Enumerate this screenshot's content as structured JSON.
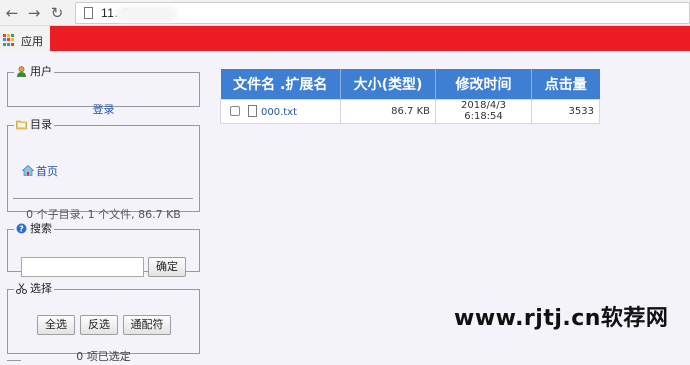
{
  "browser": {
    "url": "11.                6",
    "bookmark_apps_label": "应用",
    "accent_color": "#ec1c24"
  },
  "sidebar": {
    "user_panel": {
      "title": "用户",
      "icon": "user-icon",
      "login_link": "登录"
    },
    "directory_panel": {
      "title": "目录",
      "icon": "folder-icon",
      "home_link": "首页",
      "summary": "0 个子目录, 1 个文件, 86.7 KB"
    },
    "search_panel": {
      "title": "搜索",
      "icon": "help-icon",
      "input_value": "",
      "submit_label": "确定"
    },
    "select_panel": {
      "title": "选择",
      "icon": "scissors-icon",
      "select_all": "全选",
      "invert": "反选",
      "wildcard": "通配符",
      "selected_count": "0 项已选定"
    }
  },
  "file_table": {
    "headers": [
      "文件名 .扩展名",
      "大小(类型)",
      "修改时间",
      "点击量"
    ],
    "rows": [
      {
        "name": "000.txt",
        "size": "86.7 KB",
        "modified": "2018/4/3 6:18:54",
        "hits": "3533",
        "checked": false
      }
    ],
    "header_color": "#3e7fd3"
  },
  "watermark": "www.rjtj.cn软荐网"
}
